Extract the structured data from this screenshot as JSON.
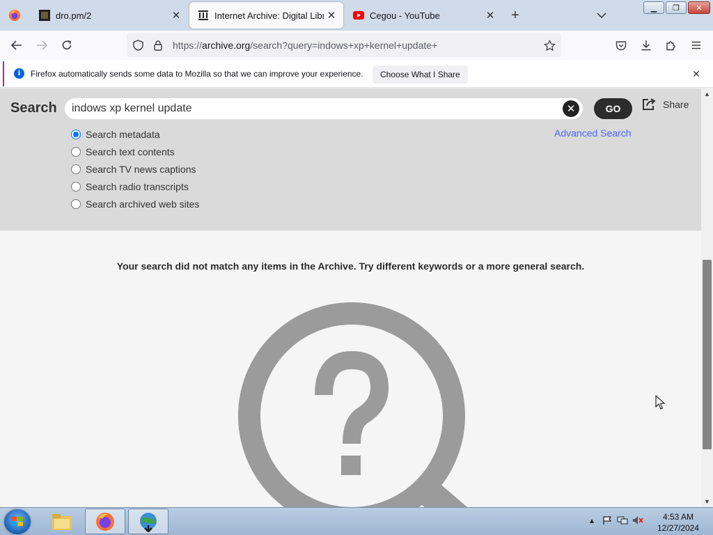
{
  "browser": {
    "tabs": [
      {
        "label": "dro.pm/2",
        "favicon": "dark-square-favicon",
        "active": false
      },
      {
        "label": "Internet Archive: Digital Library",
        "favicon": "archive-building-icon",
        "active": true
      },
      {
        "label": "Cegou - YouTube",
        "favicon": "youtube-icon",
        "active": false
      }
    ],
    "url_prefix": "https://",
    "url_domain": "archive.org",
    "url_path": "/search?query=indows+xp+kernel+update+"
  },
  "notification": {
    "message": "Firefox automatically sends some data to Mozilla so that we can improve your experience.",
    "button_label": "Choose What I Share"
  },
  "search": {
    "label": "Search",
    "query": "indows xp kernel update",
    "go_label": "GO",
    "share_label": "Share",
    "advanced_label": "Advanced Search",
    "options": [
      {
        "label": "Search metadata",
        "selected": true
      },
      {
        "label": "Search text contents",
        "selected": false
      },
      {
        "label": "Search TV news captions",
        "selected": false
      },
      {
        "label": "Search radio transcripts",
        "selected": false
      },
      {
        "label": "Search archived web sites",
        "selected": false
      }
    ]
  },
  "results": {
    "message": "Your search did not match any items in the Archive. Try different keywords or a more general search."
  },
  "taskbar": {
    "time": "4:53 AM",
    "date": "12/27/2024"
  },
  "colors": {
    "accent_link": "#4b64ff",
    "radio_selected": "#0075ff",
    "panel_bg": "#dadada",
    "magnifier_gray": "#9b9b9b"
  }
}
